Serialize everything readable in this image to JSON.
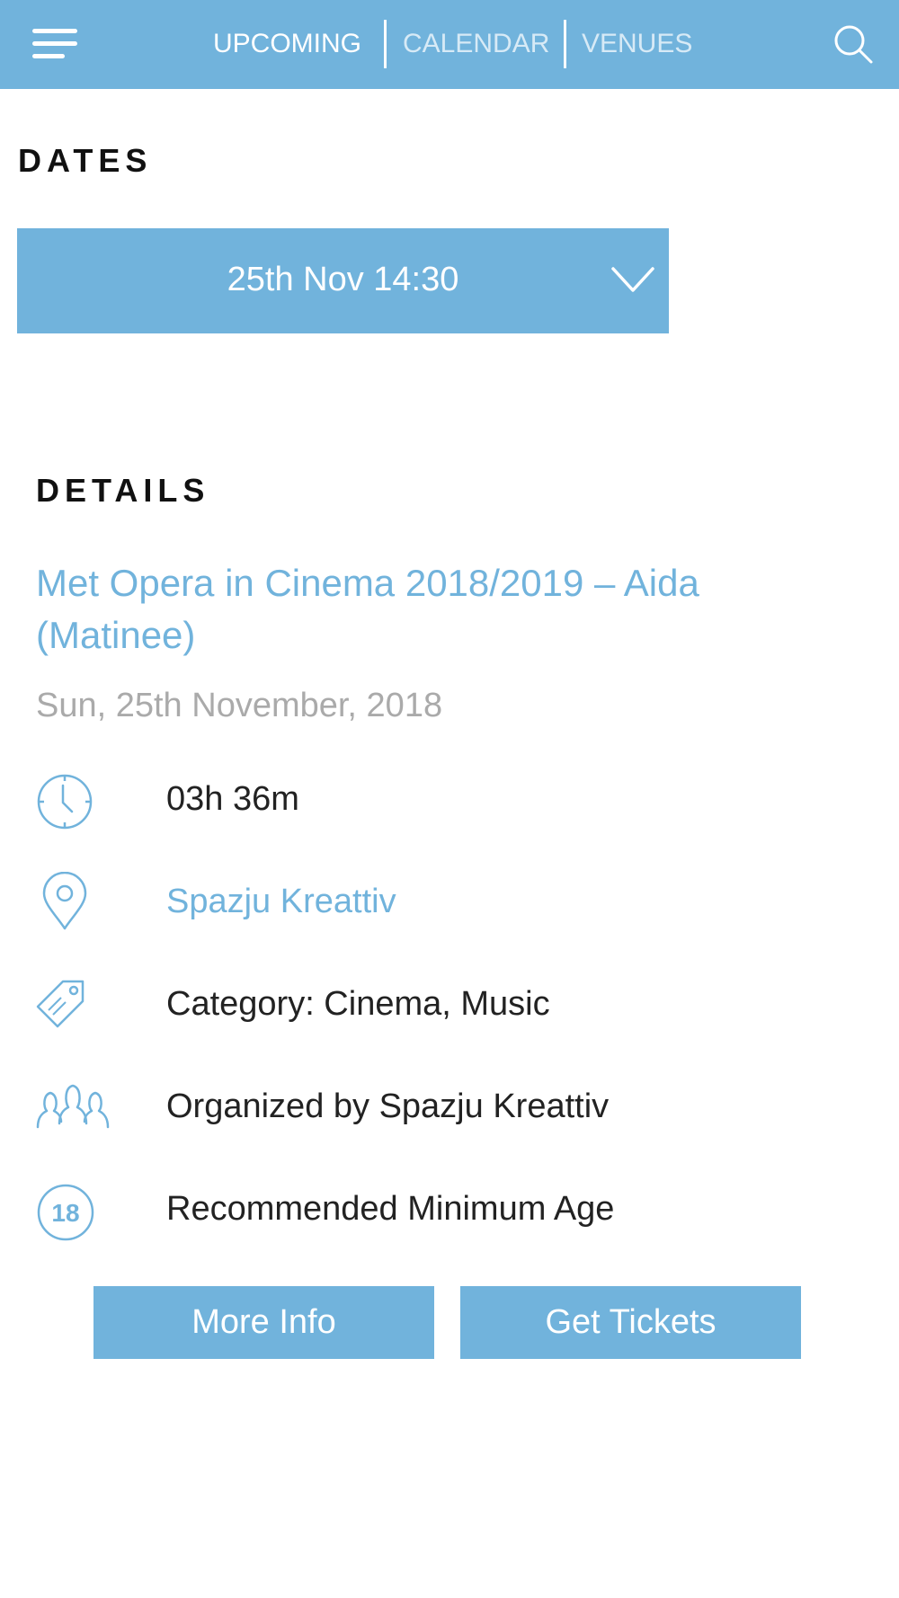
{
  "nav": {
    "menu_icon": "hamburger-menu-icon",
    "tabs": [
      {
        "label": "UPCOMING",
        "active": true
      },
      {
        "label": "CALENDAR",
        "active": false
      },
      {
        "label": "VENUES",
        "active": false
      }
    ],
    "search_icon": "search-icon"
  },
  "dates": {
    "heading": "DATES",
    "selected": "25th Nov 14:30",
    "dropdown_icon": "chevron-down-icon"
  },
  "details": {
    "heading": "DETAILS",
    "title": "Met Opera in Cinema 2018/2019 – Aida (Matinee)",
    "date": "Sun, 25th November, 2018",
    "rows": [
      {
        "icon": "clock-icon",
        "text": "03h 36m"
      },
      {
        "icon": "location-pin-icon",
        "text": "Spazju Kreattiv"
      },
      {
        "icon": "tag-icon",
        "text": "Category: Cinema, Music"
      },
      {
        "icon": "people-icon",
        "text": "Organized by Spazju Kreattiv"
      },
      {
        "icon": "age-18-icon",
        "icon_text": "18",
        "text": "Recommended Minimum Age"
      }
    ]
  },
  "actions": {
    "more_info": "More Info",
    "get_tickets": "Get Tickets"
  },
  "colors": {
    "accent": "#71b3dc",
    "muted_text": "#aaaaaa",
    "inactive_tab": "#d7eaf6"
  }
}
